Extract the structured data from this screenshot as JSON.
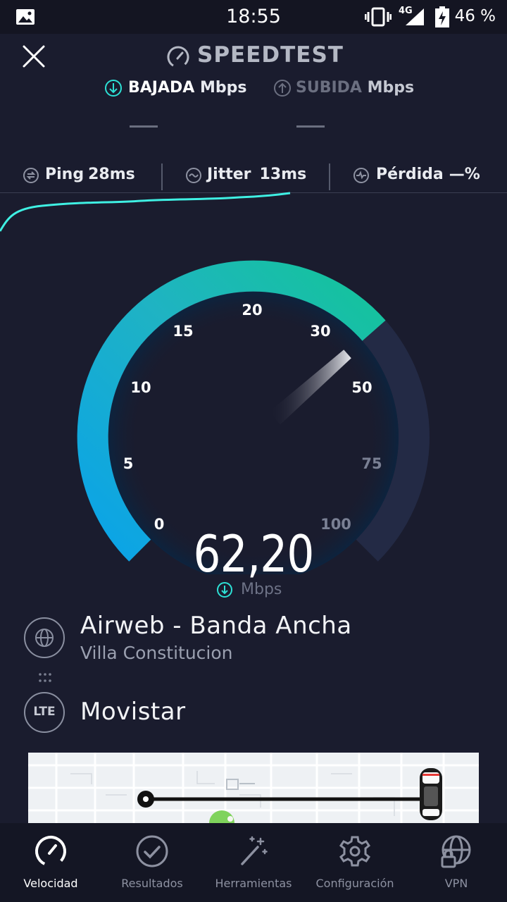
{
  "status": {
    "time": "18:55",
    "network": "4G",
    "battery": "46 %"
  },
  "header": {
    "title": "SPEEDTEST"
  },
  "tabs": {
    "download": {
      "label": "BAJADA",
      "unit": "Mbps",
      "value": "—"
    },
    "upload": {
      "label": "SUBIDA",
      "unit": "Mbps",
      "value": "—"
    }
  },
  "metrics": {
    "ping": {
      "label": "Ping",
      "value": "28ms"
    },
    "jitter": {
      "label": "Jitter",
      "value": "13ms"
    },
    "loss": {
      "label": "Pérdida",
      "value": "—%"
    }
  },
  "gauge": {
    "ticks": [
      "0",
      "5",
      "10",
      "15",
      "20",
      "30",
      "50",
      "75",
      "100"
    ],
    "speed": "62,20",
    "unit": "Mbps",
    "fill_fraction": 0.68
  },
  "isp": {
    "name": "Airweb - Banda Ancha",
    "location": "Villa Constitucion"
  },
  "carrier": {
    "badge": "LTE",
    "name": "Movistar"
  },
  "nav": [
    {
      "label": "Velocidad",
      "icon": "speedometer-icon",
      "active": true
    },
    {
      "label": "Resultados",
      "icon": "check-circle-icon",
      "active": false
    },
    {
      "label": "Herramientas",
      "icon": "magic-wand-icon",
      "active": false
    },
    {
      "label": "Configuración",
      "icon": "gear-icon",
      "active": false
    },
    {
      "label": "VPN",
      "icon": "globe-lock-icon",
      "active": false
    }
  ],
  "colors": {
    "background": "#1a1c2e",
    "accent": "#2de0d5",
    "gauge_start": "#0ea5e9",
    "gauge_end": "#14b8a6"
  }
}
